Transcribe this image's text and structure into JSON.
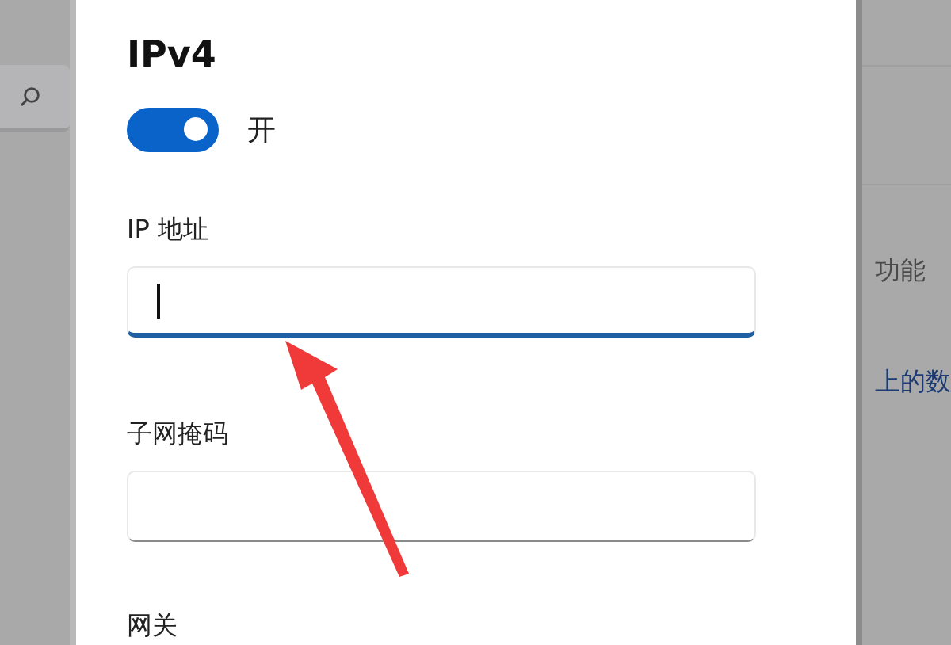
{
  "background_left": {
    "search": {
      "kind": "search"
    }
  },
  "dialog": {
    "title": "IPv4",
    "toggle": {
      "on": true,
      "label": "开"
    },
    "fields": [
      {
        "kind": "field",
        "label": "IP 地址",
        "focused": true
      },
      {
        "kind": "field",
        "label": "子网掩码",
        "focused": false
      },
      {
        "kind": "label",
        "label": "网关"
      }
    ]
  },
  "background_right": {
    "texts": [
      {
        "kind": "text",
        "text": "功能"
      },
      {
        "kind": "link",
        "text": "上的数"
      }
    ]
  }
}
